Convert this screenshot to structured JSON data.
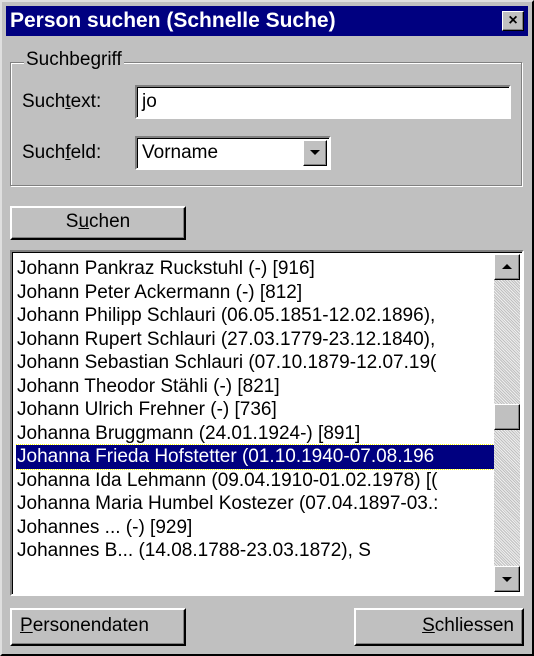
{
  "window": {
    "title": "Person suchen (Schnelle Suche)",
    "close_glyph": "×"
  },
  "group": {
    "label": "Suchbegriff"
  },
  "search_text": {
    "label_pre": "Such",
    "label_accel": "t",
    "label_post": "ext:",
    "value": "jo"
  },
  "search_field": {
    "label_pre": "Such",
    "label_accel": "f",
    "label_post": "eld:",
    "value": "Vorname"
  },
  "buttons": {
    "search": {
      "pre": "S",
      "accel": "u",
      "post": "chen"
    },
    "person_data": {
      "pre": "",
      "accel": "P",
      "post": "ersonendaten"
    },
    "close": {
      "pre": "",
      "accel": "S",
      "post": "chliessen"
    }
  },
  "results": {
    "selected_index": 8,
    "items": [
      "Johann Pankraz Ruckstuhl (-) [916]",
      "Johann Peter Ackermann (-) [812]",
      "Johann Philipp Schlauri (06.05.1851-12.02.1896),",
      "Johann Rupert Schlauri (27.03.1779-23.12.1840),",
      "Johann Sebastian Schlauri (07.10.1879-12.07.19(",
      "Johann Theodor Stähli (-) [821]",
      "Johann Ulrich Frehner (-) [736]",
      "Johanna Bruggmann (24.01.1924-) [891]",
      "Johanna Frieda Hofstetter (01.10.1940-07.08.196",
      "Johanna Ida Lehmann (09.04.1910-01.02.1978) [(",
      "Johanna Maria Humbel Kostezer (07.04.1897-03.:",
      "Johannes ... (-) [929]",
      "Johannes B... (14.08.1788-23.03.1872), S"
    ]
  },
  "icons": {
    "close": "close-icon",
    "dropdown": "chevron-down-icon",
    "scroll_up": "arrow-up-icon",
    "scroll_down": "arrow-down-icon"
  },
  "colors": {
    "titlebar": "#000080",
    "selection": "#000080",
    "face": "#c0c0c0"
  }
}
